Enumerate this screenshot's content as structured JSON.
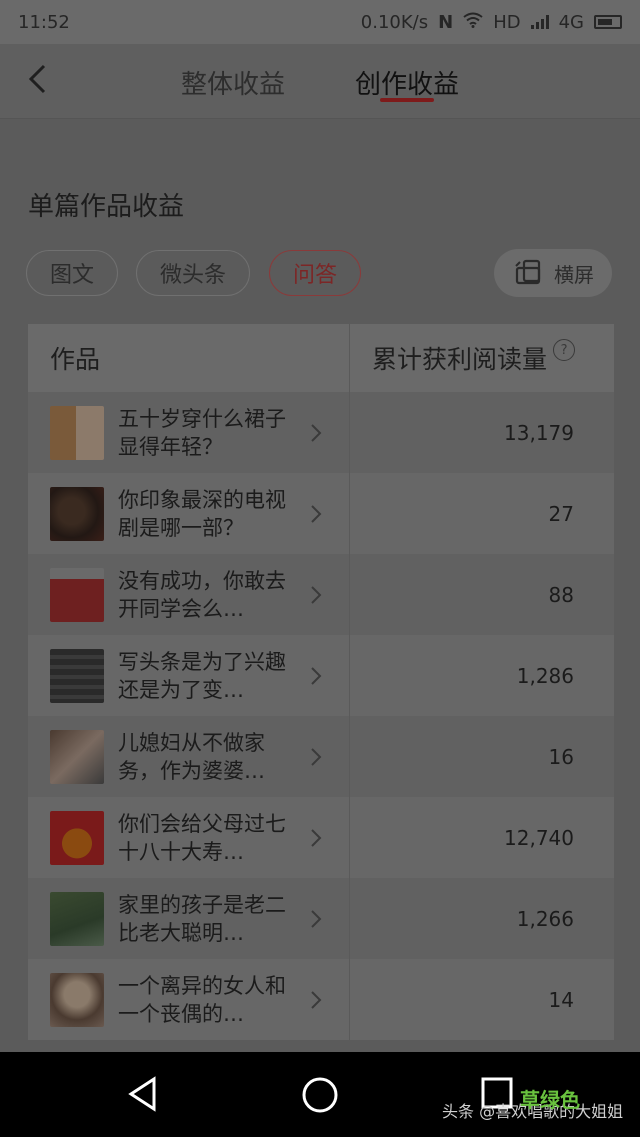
{
  "status_bar": {
    "time": "11:52",
    "net_speed": "0.10K/s",
    "hd": "HD",
    "network": "4G"
  },
  "nav": {
    "tabs": [
      {
        "label": "整体收益",
        "active": false
      },
      {
        "label": "创作收益",
        "active": true
      }
    ]
  },
  "section": {
    "title": "单篇作品收益"
  },
  "filters": {
    "chips": [
      {
        "label": "图文",
        "active": false
      },
      {
        "label": "微头条",
        "active": false
      },
      {
        "label": "问答",
        "active": true
      }
    ],
    "landscape_label": "横屏"
  },
  "table": {
    "columns": [
      "作品",
      "累计获利阅读量"
    ],
    "help_icon": "?",
    "rows": [
      {
        "title": "五十岁穿什么裙子显得年轻？",
        "views": "13,179",
        "thumb": "fashion-photo"
      },
      {
        "title": "你印象最深的电视剧是哪一部？",
        "views": "27",
        "thumb": "drama-poster"
      },
      {
        "title": "没有成功，你敢去开同学会么…",
        "views": "88",
        "thumb": "tshirt-photo"
      },
      {
        "title": "写头条是为了兴趣还是为了变…",
        "views": "1,286",
        "thumb": "screenshot"
      },
      {
        "title": "儿媳妇从不做家务，作为婆婆…",
        "views": "16",
        "thumb": "woman-car-photo"
      },
      {
        "title": "你们会给父母过七十八十大寿…",
        "views": "12,740",
        "thumb": "birthday-poster"
      },
      {
        "title": "家里的孩子是老二比老大聪明…",
        "views": "1,266",
        "thumb": "tree-photo"
      },
      {
        "title": "一个离异的女人和一个丧偶的…",
        "views": "14",
        "thumb": "woman-portrait"
      }
    ]
  },
  "watermark": {
    "text": "头条 @喜欢唱歌的大姐姐",
    "logo": "草绿色"
  },
  "colors": {
    "accent": "#d6363a",
    "overlay": "#5b5b5b"
  }
}
